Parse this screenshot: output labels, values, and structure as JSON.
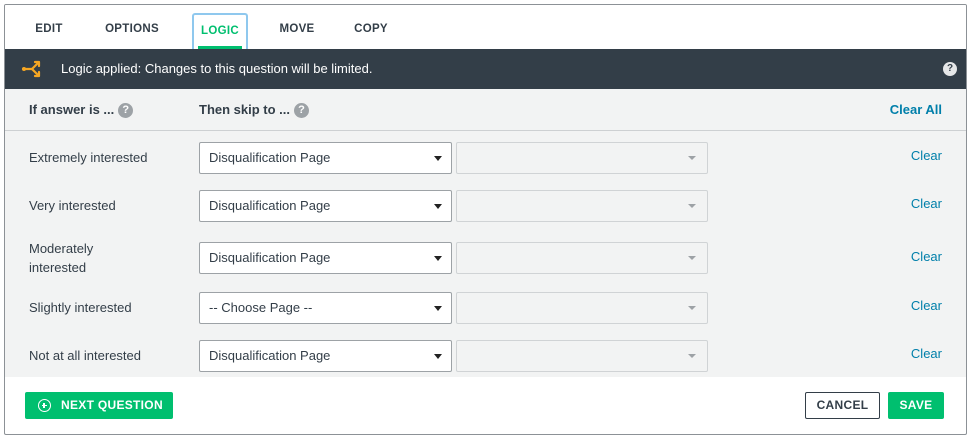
{
  "tabs": [
    {
      "label": "EDIT"
    },
    {
      "label": "OPTIONS"
    },
    {
      "label": "LOGIC"
    },
    {
      "label": "MOVE"
    },
    {
      "label": "COPY"
    }
  ],
  "banner": {
    "text": "Logic applied: Changes to this question will be limited.",
    "help": "?"
  },
  "header": {
    "answer_col": "If answer is ...",
    "skip_col": "Then skip to ...",
    "help": "?",
    "clear_all": "Clear All"
  },
  "rows": [
    {
      "answer": "Extremely interested",
      "page": "Disqualification Page",
      "question": "",
      "clear": "Clear"
    },
    {
      "answer": "Very interested",
      "page": "Disqualification Page",
      "question": "",
      "clear": "Clear"
    },
    {
      "answer": "Moderately interested",
      "page": "Disqualification Page",
      "question": "",
      "clear": "Clear"
    },
    {
      "answer": "Slightly interested",
      "page": "-- Choose Page --",
      "question": "",
      "clear": "Clear"
    },
    {
      "answer": "Not at all interested",
      "page": "Disqualification Page",
      "question": "",
      "clear": "Clear"
    }
  ],
  "footer": {
    "next_question": "NEXT QUESTION",
    "cancel": "CANCEL",
    "save": "SAVE"
  },
  "colors": {
    "accent": "#00bf6f",
    "banner_bg": "#333e48",
    "link": "#007faa",
    "logic_icon": "#f5a623"
  }
}
